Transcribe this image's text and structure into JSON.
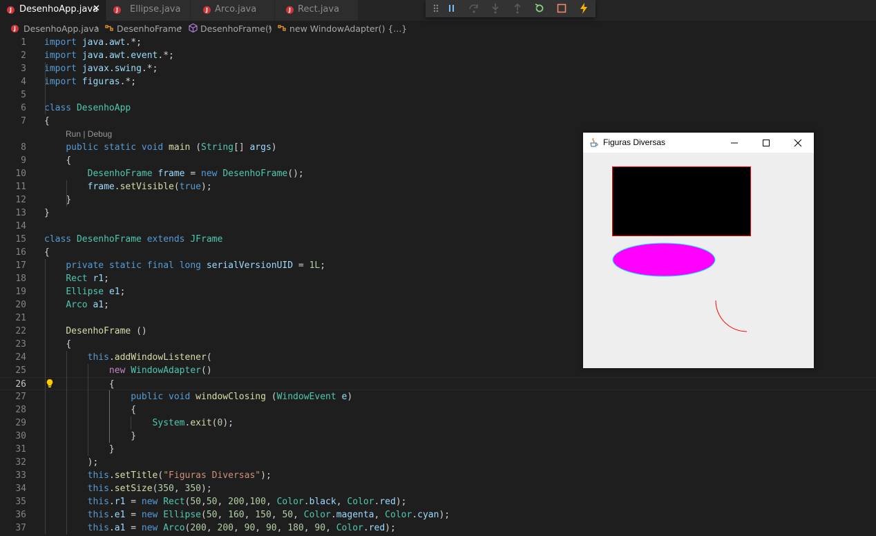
{
  "tabs": [
    {
      "label": "DesenhoApp.java",
      "active": true,
      "close": "✕"
    },
    {
      "label": "Ellipse.java",
      "active": false
    },
    {
      "label": "Arco.java",
      "active": false
    },
    {
      "label": "Rect.java",
      "active": false
    }
  ],
  "tab_icon_letter": "J",
  "debug_toolbar": [
    "grip",
    "pause",
    "step-over",
    "step-into",
    "step-out",
    "restart",
    "stop",
    "hot-code-replace"
  ],
  "breadcrumb": [
    "DesenhoApp.java",
    "DesenhoFrame",
    "DesenhoFrame()",
    "new WindowAdapter() {...}"
  ],
  "codelens": "Run | Debug",
  "current_line": 26,
  "lines": [
    {
      "n": "1",
      "t": "import java.awt.*;"
    },
    {
      "n": "2",
      "t": "import java.awt.event.*;"
    },
    {
      "n": "3",
      "t": "import javax.swing.*;"
    },
    {
      "n": "4",
      "t": "import figuras.*;"
    },
    {
      "n": "5",
      "t": ""
    },
    {
      "n": "6",
      "t": "class DesenhoApp"
    },
    {
      "n": "7",
      "t": "{"
    },
    {
      "n": "8",
      "t": "    public static void main (String[] args)"
    },
    {
      "n": "9",
      "t": "    {"
    },
    {
      "n": "10",
      "t": "        DesenhoFrame frame = new DesenhoFrame();"
    },
    {
      "n": "11",
      "t": "        frame.setVisible(true);"
    },
    {
      "n": "12",
      "t": "    }"
    },
    {
      "n": "13",
      "t": "}"
    },
    {
      "n": "14",
      "t": ""
    },
    {
      "n": "15",
      "t": "class DesenhoFrame extends JFrame"
    },
    {
      "n": "16",
      "t": "{"
    },
    {
      "n": "17",
      "t": "    private static final long serialVersionUID = 1L;"
    },
    {
      "n": "18",
      "t": "    Rect r1;"
    },
    {
      "n": "19",
      "t": "    Ellipse e1;"
    },
    {
      "n": "20",
      "t": "    Arco a1;"
    },
    {
      "n": "21",
      "t": ""
    },
    {
      "n": "22",
      "t": "    DesenhoFrame ()"
    },
    {
      "n": "23",
      "t": "    {"
    },
    {
      "n": "24",
      "t": "        this.addWindowListener("
    },
    {
      "n": "25",
      "t": "            new WindowAdapter()"
    },
    {
      "n": "26",
      "t": "            {"
    },
    {
      "n": "27",
      "t": "                public void windowClosing (WindowEvent e)"
    },
    {
      "n": "28",
      "t": "                {"
    },
    {
      "n": "29",
      "t": "                    System.exit(0);"
    },
    {
      "n": "30",
      "t": "                }"
    },
    {
      "n": "31",
      "t": "            }"
    },
    {
      "n": "32",
      "t": "        );"
    },
    {
      "n": "33",
      "t": "        this.setTitle(\"Figuras Diversas\");"
    },
    {
      "n": "34",
      "t": "        this.setSize(350, 350);"
    },
    {
      "n": "35",
      "t": "        this.r1 = new Rect(50,50, 200,100, Color.black, Color.red);"
    },
    {
      "n": "36",
      "t": "        this.e1 = new Ellipse(50, 160, 150, 50, Color.magenta, Color.cyan);"
    },
    {
      "n": "37",
      "t": "        this.a1 = new Arco(200, 200, 90, 90, 180, 90, Color.red);"
    }
  ],
  "java_window": {
    "title": "Figuras Diversas",
    "controls": [
      "minimize",
      "maximize",
      "close"
    ],
    "colors": {
      "background": "#eeeeee",
      "rect_fill": "#000000",
      "rect_border": "#ff0000",
      "ellipse_fill": "#ff00ff",
      "ellipse_border": "#00ffff",
      "arc": "#ff0000"
    }
  }
}
